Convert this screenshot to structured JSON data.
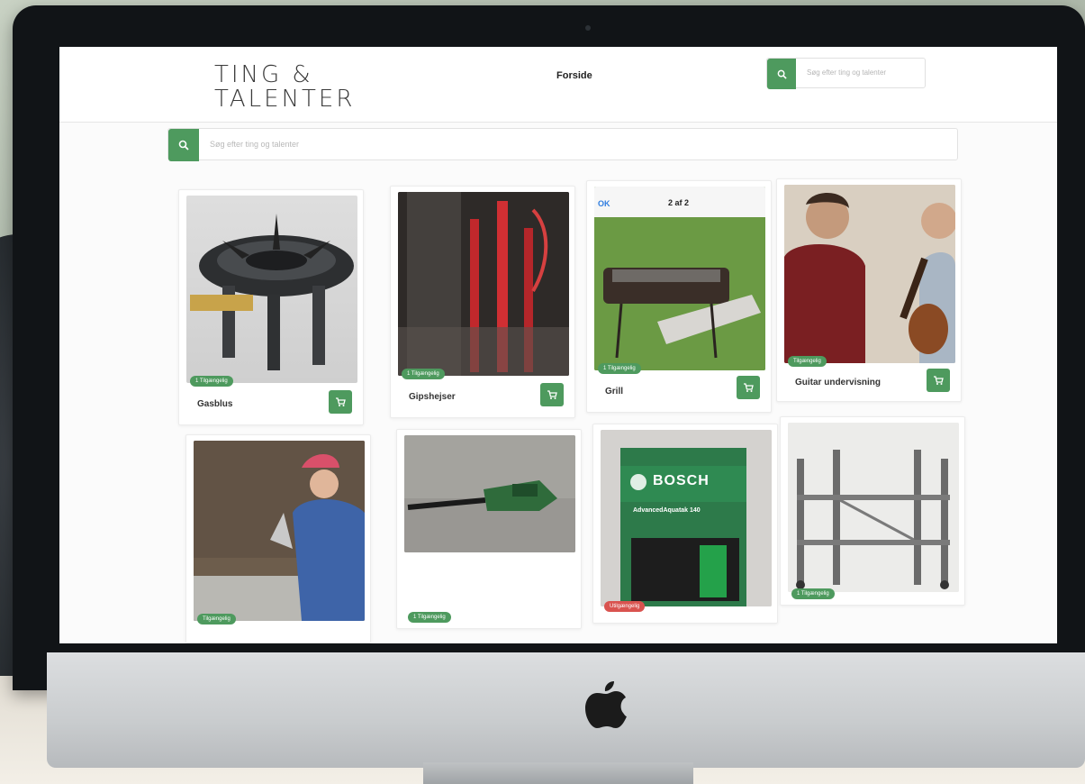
{
  "site": {
    "logo_line1": "TING &",
    "logo_line2": "TALENTER",
    "nav_forside": "Forside",
    "nav_search_placeholder": "Søg efter ting og talenter",
    "main_search_placeholder": "Søg efter ting og talenter"
  },
  "colors": {
    "accent": "#4e9a5e",
    "unavailable": "#d9534f"
  },
  "products": [
    {
      "title": "Gasblus",
      "status": "1 Tilgængelig",
      "image": "gas-burner-photo",
      "cart_icon": "cart-icon"
    },
    {
      "title": "Gipshejser",
      "status": "1 Tilgængelig",
      "image": "drywall-lift-photo",
      "cart_icon": "cart-icon"
    },
    {
      "title": "Grill",
      "status": "1 Tilgængelig",
      "image": "grill-photo",
      "phone_ok": "OK",
      "phone_counter": "2 af 2",
      "cart_icon": "cart-icon"
    },
    {
      "title": "Guitar undervisning",
      "status": "Tilgængelig",
      "image": "guitar-lesson-photo",
      "cart_icon": "cart-icon"
    },
    {
      "title": "",
      "status": "Tilgængelig",
      "image": "mason-photo"
    },
    {
      "title": "",
      "status": "1 Tilgængelig",
      "image": "hedge-trimmer-photo"
    },
    {
      "title": "",
      "status": "Utilgængelig",
      "image": "bosch-pressure-washer-photo",
      "brand_text": "BOSCH",
      "product_text": "AdvancedAquatak 140"
    },
    {
      "title": "",
      "status": "1 Tilgængelig",
      "image": "scaffold-photo"
    }
  ]
}
